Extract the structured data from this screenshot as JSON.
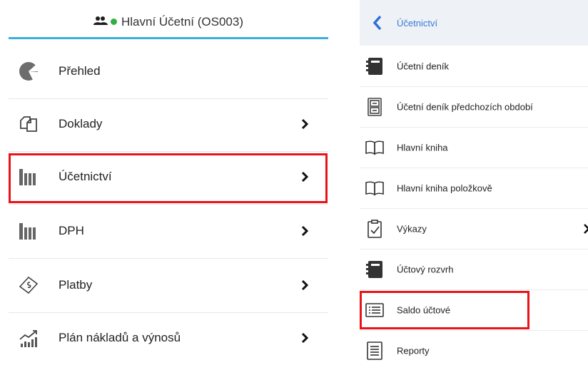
{
  "left_panel": {
    "header": {
      "title": "Hlavní Účetní (OS003)",
      "status_color": "#2eb043"
    },
    "items": [
      {
        "label": "Přehled",
        "icon": "pie-chart-icon",
        "has_chevron": false
      },
      {
        "label": "Doklady",
        "icon": "documents-icon",
        "has_chevron": true
      },
      {
        "label": "Účetnictví",
        "icon": "books-icon",
        "has_chevron": true,
        "highlighted": true
      },
      {
        "label": "DPH",
        "icon": "books-icon",
        "has_chevron": true
      },
      {
        "label": "Platby",
        "icon": "banknote-icon",
        "has_chevron": true
      },
      {
        "label": "Plán nákladů a výnosů",
        "icon": "growth-chart-icon",
        "has_chevron": true
      }
    ]
  },
  "right_panel": {
    "header": {
      "label": "Účetnictví",
      "icon": "back-arrow-icon"
    },
    "items": [
      {
        "label": "Účetní deník",
        "icon": "notebook-icon"
      },
      {
        "label": "Účetní deník předchozích období",
        "icon": "archive-cabinet-icon"
      },
      {
        "label": "Hlavní kniha",
        "icon": "open-book-icon"
      },
      {
        "label": "Hlavní kniha položkově",
        "icon": "open-book-icon"
      },
      {
        "label": "Výkazy",
        "icon": "clipboard-check-icon",
        "has_chevron": true
      },
      {
        "label": "Účtový rozvrh",
        "icon": "notebook-icon"
      },
      {
        "label": "Saldo účtové",
        "icon": "list-icon",
        "highlighted": true
      },
      {
        "label": "Reporty",
        "icon": "report-list-icon"
      }
    ]
  },
  "colors": {
    "accent": "#3ab0df",
    "highlight": "#e8141a",
    "link": "#3a78d8"
  }
}
